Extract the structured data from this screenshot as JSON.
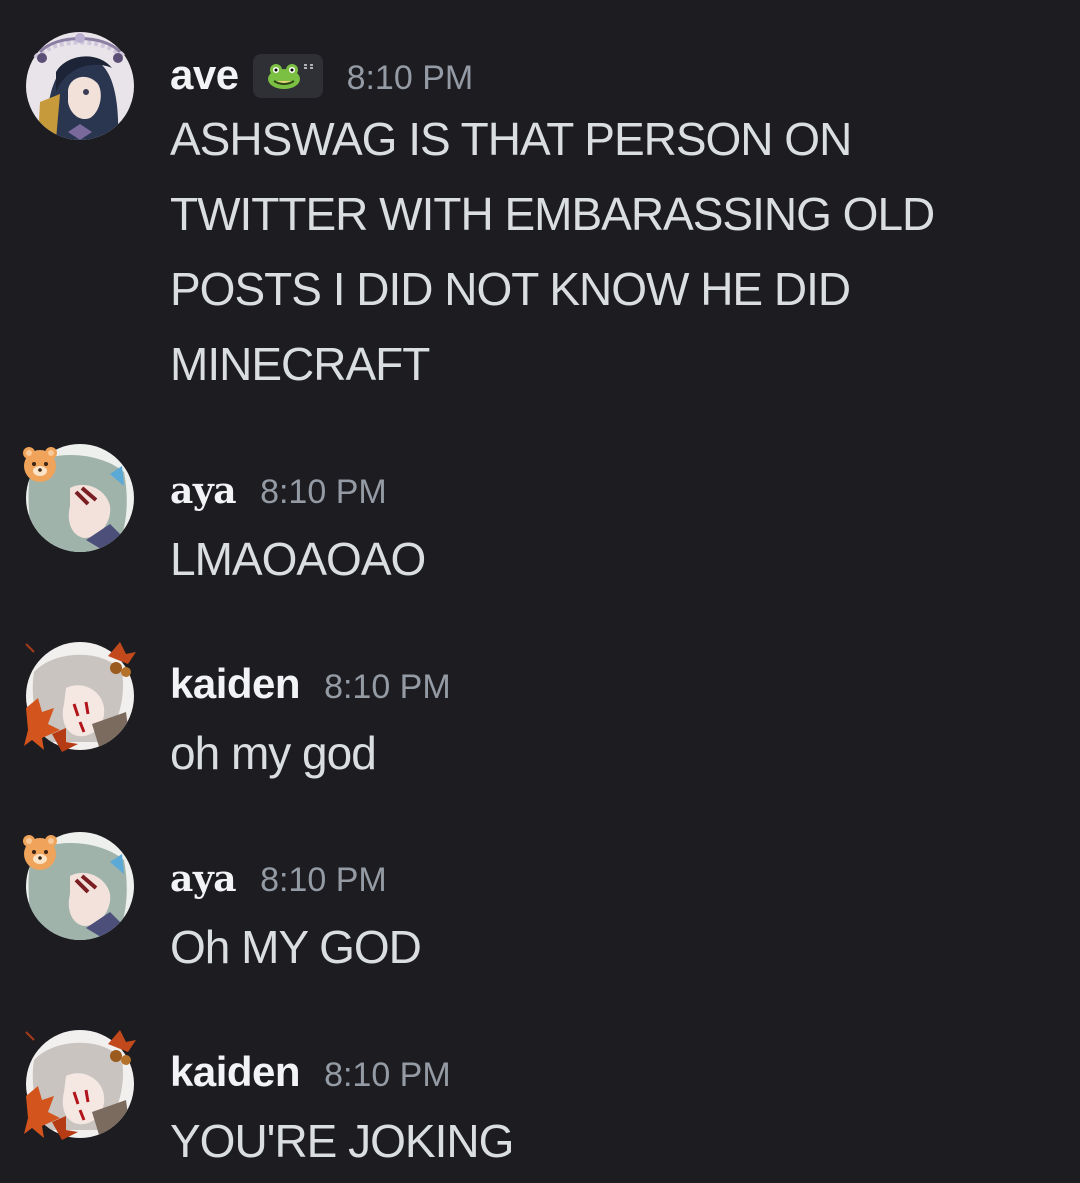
{
  "messages": [
    {
      "username": "ave",
      "timestamp": "8:10 PM",
      "content": "ASHSWAG IS THAT PERSON ON TWITTER WITH EMBARASSING OLD POSTS I DID NOT KNOW HE DID MINECRAFT",
      "tag_icon": "frog-icon"
    },
    {
      "username": "aya",
      "timestamp": "8:10 PM",
      "content": "LMAOAOAO"
    },
    {
      "username": "kaiden",
      "timestamp": "8:10 PM",
      "content": "oh my god"
    },
    {
      "username": "aya",
      "timestamp": "8:10 PM",
      "content": "Oh MY GOD"
    },
    {
      "username": "kaiden",
      "timestamp": "8:10 PM",
      "content": "YOU'RE JOKING"
    }
  ],
  "colors": {
    "background": "#1c1c21",
    "username": "#f2f3f5",
    "text": "#dbdee1",
    "timestamp": "#949ba4"
  }
}
